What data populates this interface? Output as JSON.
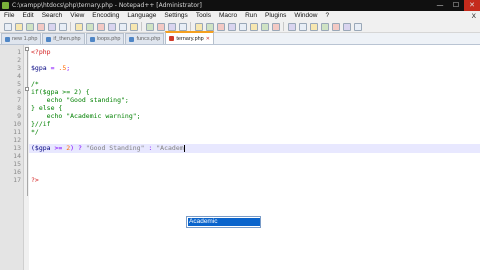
{
  "window": {
    "title": "C:\\xampp\\htdocs\\php\\ternary.php - Notepad++ [Administrator]",
    "minimize_glyph": "—",
    "maximize_glyph": "☐",
    "close_glyph": "✕"
  },
  "menu": {
    "items": [
      "File",
      "Edit",
      "Search",
      "View",
      "Encoding",
      "Language",
      "Settings",
      "Tools",
      "Macro",
      "Run",
      "Plugins",
      "Window",
      "?"
    ],
    "close_glyph": "X"
  },
  "toolbar": {
    "icons": [
      "new-file",
      "open-file",
      "save",
      "save-all",
      "close",
      "close-all",
      "print",
      "cut",
      "copy",
      "paste",
      "undo",
      "redo",
      "find",
      "replace",
      "zoom-in",
      "zoom-out",
      "sync-v",
      "sync-h",
      "word-wrap",
      "show-all",
      "indent-guide",
      "lang",
      "doc-map",
      "function-list",
      "folder",
      "monitor",
      "record",
      "stop",
      "play",
      "play-multi",
      "save-macro"
    ]
  },
  "tabs": [
    {
      "label": "new 1.php",
      "active": false
    },
    {
      "label": "if_then.php",
      "active": false
    },
    {
      "label": "loops.php",
      "active": false
    },
    {
      "label": "funcs.php",
      "active": false
    },
    {
      "label": "ternary.php",
      "active": true
    }
  ],
  "editor": {
    "line_numbers": [
      "1",
      "2",
      "3",
      "4",
      "5",
      "6",
      "7",
      "8",
      "9",
      "10",
      "11",
      "12",
      "13",
      "14",
      "15",
      "16",
      "17"
    ],
    "lines": [
      [
        {
          "t": "<?php",
          "c": "tk-php"
        }
      ],
      [],
      [
        {
          "t": "$gpa",
          "c": "tk-var"
        },
        {
          "t": " = ",
          "c": "tk-op"
        },
        {
          "t": ".5",
          "c": "tk-num"
        },
        {
          "t": ";",
          "c": "tk-op"
        }
      ],
      [],
      [
        {
          "t": "/*",
          "c": "tk-cm"
        }
      ],
      [
        {
          "t": "if($gpa >= 2) {",
          "c": "tk-cm"
        }
      ],
      [
        {
          "t": "    echo \"Good standing\";",
          "c": "tk-cm"
        }
      ],
      [
        {
          "t": "} else {",
          "c": "tk-cm"
        }
      ],
      [
        {
          "t": "    echo \"Academic warning\";",
          "c": "tk-cm"
        }
      ],
      [
        {
          "t": "}//if",
          "c": "tk-cm"
        }
      ],
      [
        {
          "t": "*/",
          "c": "tk-cm"
        }
      ],
      [],
      [
        {
          "t": "($gpa",
          "c": "tk-var"
        },
        {
          "t": " >= ",
          "c": "tk-op"
        },
        {
          "t": "2",
          "c": "tk-num"
        },
        {
          "t": ") ? ",
          "c": "tk-op"
        },
        {
          "t": "\"Good Standing\"",
          "c": "tk-str"
        },
        {
          "t": " : ",
          "c": "tk-op"
        },
        {
          "t": "\"Academ",
          "c": "tk-str"
        }
      ],
      [],
      [],
      [],
      [
        {
          "t": "?>",
          "c": "tk-php"
        }
      ]
    ],
    "current_line": 13
  },
  "autocomplete": {
    "items": [
      "Academic"
    ],
    "selected_index": 0
  },
  "colors": {
    "php_tag": "#d21b1b",
    "variable": "#000080",
    "operator": "#8000ff",
    "number": "#ff6a00",
    "string": "#808080",
    "comment": "#008000",
    "current_line_bg": "#e8e8ff",
    "selection": "#0a64cc"
  }
}
